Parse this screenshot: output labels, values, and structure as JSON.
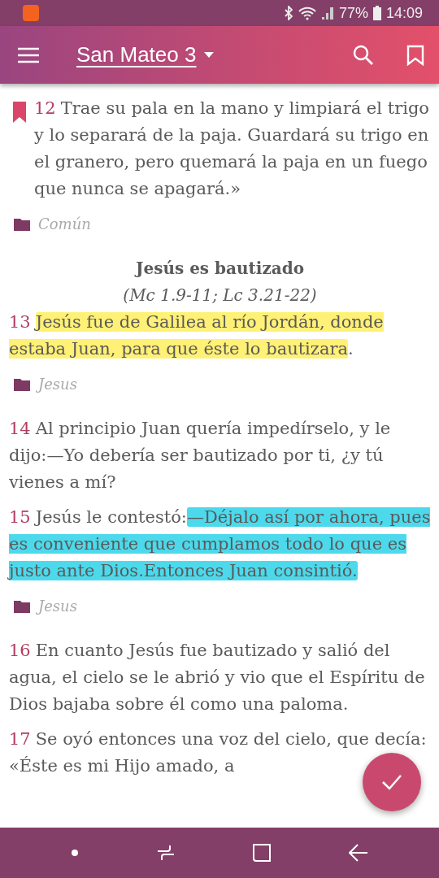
{
  "status_bar": {
    "battery": "77%",
    "time": "14:09"
  },
  "app_bar": {
    "title": "San Mateo 3"
  },
  "items": [
    {
      "kind": "verse",
      "number": "12",
      "bookmarked": true,
      "segments": [
        {
          "text": "Trae su pala en la mano y limpiará el trigo y lo separará de la paja. Guardará su trigo en el granero, pero quemará la paja en un fuego que nunca se apagará.»"
        }
      ]
    },
    {
      "kind": "tag",
      "label": "Común"
    },
    {
      "kind": "heading",
      "title": "Jesús es bautizado",
      "reference": "(Mc 1.9-11; Lc 3.21-22)"
    },
    {
      "kind": "verse",
      "number": "13",
      "bookmarked": false,
      "segments": [
        {
          "text": "Jesús fue de Galilea al río Jordán, donde estaba Juan, para que éste lo bautizara",
          "color": "#fff176"
        },
        {
          "text": "."
        }
      ]
    },
    {
      "kind": "tag",
      "label": "Jesus"
    },
    {
      "kind": "verse",
      "number": "14",
      "bookmarked": false,
      "segments": [
        {
          "text": "Al principio Juan quería impedírselo, y le dijo:—Yo debería ser bautizado por ti, ¿y tú vienes a mí?"
        }
      ]
    },
    {
      "kind": "verse",
      "number": "15",
      "bookmarked": false,
      "segments": [
        {
          "text": "Jesús le contestó:"
        },
        {
          "text": "—Déjalo así por ahora, pues es conveniente que cumplamos todo lo que es justo ante Dios.Entonces Juan consintió.",
          "color": "#4dd9ec"
        }
      ]
    },
    {
      "kind": "tag",
      "label": "Jesus"
    },
    {
      "kind": "verse",
      "number": "16",
      "bookmarked": false,
      "segments": [
        {
          "text": "En cuanto Jesús fue bautizado y salió del agua, el cielo se le abrió y vio que el Espíritu de Dios bajaba sobre él como una paloma."
        }
      ]
    },
    {
      "kind": "verse",
      "number": "17",
      "bookmarked": false,
      "segments": [
        {
          "text": "Se oyó entonces una voz del cielo, que decía: «Éste es mi Hijo amado, a"
        }
      ]
    }
  ]
}
